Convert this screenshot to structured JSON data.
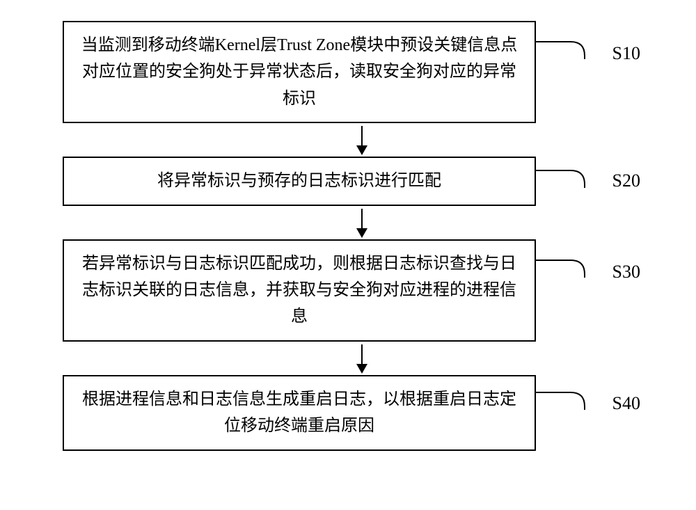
{
  "flowchart": {
    "steps": [
      {
        "text": "当监测到移动终端Kernel层Trust Zone模块中预设关键信息点对应位置的安全狗处于异常状态后，读取安全狗对应的异常标识",
        "label": "S10"
      },
      {
        "text": "将异常标识与预存的日志标识进行匹配",
        "label": "S20"
      },
      {
        "text": "若异常标识与日志标识匹配成功，则根据日志标识查找与日志标识关联的日志信息，并获取与安全狗对应进程的进程信息",
        "label": "S30"
      },
      {
        "text": "根据进程信息和日志信息生成重启日志，以根据重启日志定位移动终端重启原因",
        "label": "S40"
      }
    ]
  }
}
